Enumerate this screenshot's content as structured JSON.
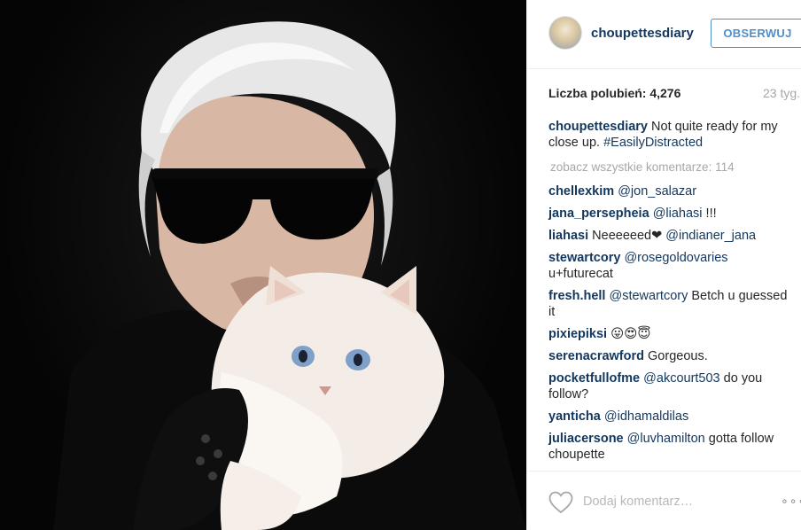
{
  "post": {
    "username": "choupettesdiary",
    "follow_label": "OBSERWUJ",
    "likes_text": "Liczba polubień: 4,276",
    "time": "23 tyg.",
    "caption_user": "choupettesdiary",
    "caption_text": "Not quite ready for my close up.",
    "caption_tag": "#EasilyDistracted",
    "view_all": "zobacz wszystkie komentarze: 114",
    "add_comment_placeholder": "Dodaj komentarz…",
    "more_label": "∘∘∘"
  },
  "comments": [
    {
      "user": "chellexkim",
      "tag": "@jon_salazar",
      "text": ""
    },
    {
      "user": "jana_persepheia",
      "tag": "@liahasi",
      "text": "!!!"
    },
    {
      "user": "liahasi",
      "text": "Neeeeeed❤",
      "tag": "@indianer_jana"
    },
    {
      "user": "stewartcory",
      "tag": "@rosegoldovaries",
      "text": "u+futurecat"
    },
    {
      "user": "fresh.hell",
      "tag": "@stewartcory",
      "text": "Betch u guessed it"
    },
    {
      "user": "pixiepiksi",
      "text": "😛😍😇"
    },
    {
      "user": "serenacrawford",
      "text": "Gorgeous."
    },
    {
      "user": "pocketfullofme",
      "tag": "@akcourt503",
      "text": "do you follow?"
    },
    {
      "user": "yanticha",
      "tag": "@idhamaldilas",
      "text": ""
    },
    {
      "user": "juliacersone",
      "tag": "@luvhamilton",
      "text": "gotta follow choupette"
    }
  ],
  "icons": {
    "heart": "heart-icon",
    "more": "more-options-icon"
  },
  "colors": {
    "username": "#12375e",
    "follow": "#4f8fc9",
    "muted": "#a5a7aa"
  }
}
